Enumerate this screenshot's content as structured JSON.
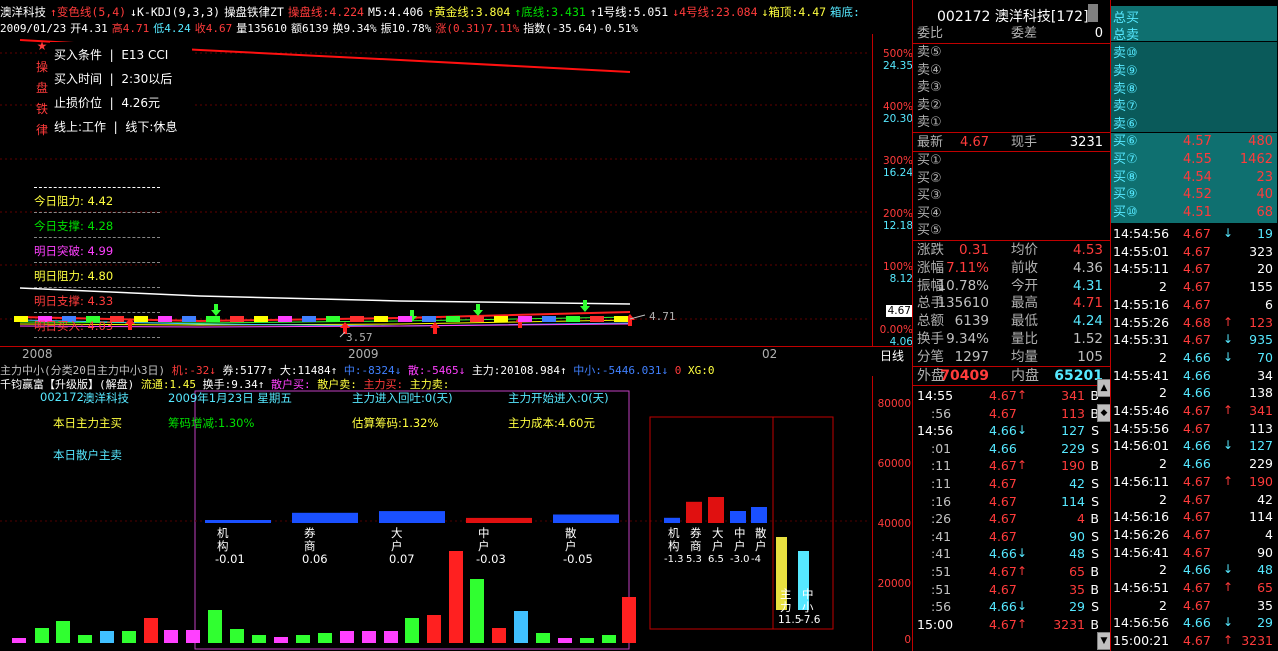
{
  "header": {
    "row1": [
      "澳洋科技",
      "↑变色线(5,4)",
      "↓K-KDJ(9,3,3)",
      "操盘铁律ZT",
      "操盘线:4.224",
      "M5:4.406",
      "↑黄金线:3.804",
      "↑底线:3.431",
      "↑1号线:5.051",
      "↓4号线:23.084",
      "↓箱顶:4.47",
      "箱底:"
    ],
    "row2": [
      "2009/01/23",
      "开4.31",
      "高4.71",
      "低4.24",
      "收4.67",
      "量135610",
      "额6139",
      "换9.34%",
      "振10.78%",
      "涨(0.31)7.11%",
      "指数(-35.64)-0.51%"
    ]
  },
  "kchart": {
    "vertical_text": [
      "★",
      "操",
      "盘",
      "铁",
      "律"
    ],
    "buy_card": [
      {
        "k": "买入条件",
        "v": "E13 CCI"
      },
      {
        "k": "买入时间",
        "v": "2:30以后"
      },
      {
        "k": "止损价位",
        "v": "4.26元"
      },
      {
        "k": "线上:工作",
        "v": "线下:休息"
      }
    ],
    "levels": [
      {
        "label": "今日阻力:",
        "value": "4.42",
        "color": "#ffff40"
      },
      {
        "label": "今日支撑:",
        "value": "4.28",
        "color": "#00e000"
      },
      {
        "label": "明日突破:",
        "value": "4.99",
        "color": "#ff40ff"
      },
      {
        "label": "明日阻力:",
        "value": "4.80",
        "color": "#ffff40"
      },
      {
        "label": "明日支撑:",
        "value": "4.33",
        "color": "#ff3b3b"
      },
      {
        "label": "明日买入:",
        "value": "4.03",
        "color": "#ff3b3b"
      }
    ],
    "price_marker": "4.71",
    "low_marker": "3.57",
    "x_labels": [
      "2008",
      "2009",
      "02"
    ],
    "period_label": "日线"
  },
  "scale": [
    {
      "pct": "500%",
      "price": "24.35"
    },
    {
      "pct": "400%",
      "price": "20.30"
    },
    {
      "pct": "300%",
      "price": "16.24"
    },
    {
      "pct": "200%",
      "price": "12.18"
    },
    {
      "pct": "100%",
      "price": "8.12"
    },
    {
      "pct": "",
      "price": "4.67"
    },
    {
      "pct": "0.00%",
      "price": "4.06"
    }
  ],
  "lower": {
    "title1": [
      "主力中小(分类20日主力中小3日)",
      "机:-32↓",
      "券:5177↑",
      "大:11484↑",
      "中:-8324↓",
      "散:-5465↓",
      "主力:20108.984↑",
      "中小:-5446.031↓",
      "0",
      "XG:0"
    ],
    "title2": [
      "千钧赢富【升级版】(解盘)",
      "流通:1.45",
      "换手:9.34↑",
      "散户买:",
      "散户卖:",
      "主力买:",
      "主力卖:"
    ],
    "info": {
      "code": "002172",
      "name": "澳洋科技",
      "date": "2009年1月23日 星期五",
      "enter_back": "主力进入回吐:0(天)",
      "start": "主力开始进入:0(天)",
      "today_main": "本日主力主买",
      "chip_change": "筹码增减:1.30%",
      "est_chip": "估算筹码:1.32%",
      "cost": "主力成本:4.60元",
      "today_retail": "本日散户主卖"
    },
    "categories": [
      {
        "name": "机构",
        "value": "-0.01"
      },
      {
        "name": "券商",
        "value": "0.06"
      },
      {
        "name": "大户",
        "value": "0.07"
      },
      {
        "name": "中户",
        "value": "-0.03"
      },
      {
        "name": "散户",
        "value": "-0.05"
      }
    ],
    "mini_labels": [
      {
        "name": "机构",
        "value": "-1.3"
      },
      {
        "name": "券商",
        "value": "5.3"
      },
      {
        "name": "大户",
        "value": "6.5"
      },
      {
        "name": "中户",
        "value": "-3.0"
      },
      {
        "name": "散户",
        "value": "-4"
      }
    ],
    "main_small": [
      {
        "name": "主力",
        "value": "11.5"
      },
      {
        "name": "中小",
        "value": "-7.6"
      }
    ],
    "vol_scale": [
      "80000",
      "60000",
      "40000",
      "20000",
      "0"
    ]
  },
  "quote": {
    "title": "002172 澳洋科技[172]",
    "wb_label": "委比",
    "wc_label": "委差",
    "wc_value": "0",
    "sells": [
      "卖⑤",
      "卖④",
      "卖③",
      "卖②",
      "卖①"
    ],
    "buys": [
      "买①",
      "买②",
      "买③",
      "买④",
      "买⑤"
    ],
    "last": {
      "k": "最新",
      "v": "4.67",
      "k2": "现手",
      "v2": "3231"
    },
    "stats": [
      {
        "k": "涨跌",
        "v": "0.31",
        "k2": "均价",
        "v2": "4.53",
        "c": "#ff3b3b",
        "c2": "#ff3b3b"
      },
      {
        "k": "涨幅",
        "v": "7.11%",
        "k2": "前收",
        "v2": "4.36",
        "c": "#ff3b3b",
        "c2": "#c0c0c0"
      },
      {
        "k": "振幅",
        "v": "10.78%",
        "k2": "今开",
        "v2": "4.31",
        "c": "#c0c0c0",
        "c2": "#56e8ff"
      },
      {
        "k": "总手",
        "v": "135610",
        "k2": "最高",
        "v2": "4.71",
        "c": "#c0c0c0",
        "c2": "#ff3b3b"
      },
      {
        "k": "总额",
        "v": "6139",
        "k2": "最低",
        "v2": "4.24",
        "c": "#c0c0c0",
        "c2": "#56e8ff"
      },
      {
        "k": "换手",
        "v": "9.34%",
        "k2": "量比",
        "v2": "1.52",
        "c": "#c0c0c0",
        "c2": "#c0c0c0"
      },
      {
        "k": "分笔",
        "v": "1297",
        "k2": "均量",
        "v2": "105",
        "c": "#c0c0c0",
        "c2": "#c0c0c0"
      }
    ],
    "outer": {
      "k": "外盘",
      "v": "70409",
      "k2": "内盘",
      "v2": "65201"
    },
    "ticks": [
      {
        "t": "14:55",
        "p": "4.67",
        "a": "↑",
        "v": "341",
        "s": "B"
      },
      {
        "t": ":56",
        "p": "4.67",
        "a": "",
        "v": "113",
        "s": "B"
      },
      {
        "t": "14:56",
        "p": "4.66",
        "a": "↓",
        "v": "127",
        "s": "S"
      },
      {
        "t": ":01",
        "p": "4.66",
        "a": "",
        "v": "229",
        "s": "S"
      },
      {
        "t": ":11",
        "p": "4.67",
        "a": "↑",
        "v": "190",
        "s": "B"
      },
      {
        "t": ":11",
        "p": "4.67",
        "a": "",
        "v": "42",
        "s": "S"
      },
      {
        "t": ":16",
        "p": "4.67",
        "a": "",
        "v": "114",
        "s": "S"
      },
      {
        "t": ":26",
        "p": "4.67",
        "a": "",
        "v": "4",
        "s": "B"
      },
      {
        "t": ":41",
        "p": "4.67",
        "a": "",
        "v": "90",
        "s": "S"
      },
      {
        "t": ":41",
        "p": "4.66",
        "a": "↓",
        "v": "48",
        "s": "S"
      },
      {
        "t": ":51",
        "p": "4.67",
        "a": "↑",
        "v": "65",
        "s": "B"
      },
      {
        "t": ":51",
        "p": "4.67",
        "a": "",
        "v": "35",
        "s": "B"
      },
      {
        "t": ":56",
        "p": "4.66",
        "a": "↓",
        "v": "29",
        "s": "S"
      },
      {
        "t": "15:00",
        "p": "4.67",
        "a": "↑",
        "v": "3231",
        "s": "B"
      }
    ]
  },
  "detail": {
    "total_buy": "总买",
    "total_sell": "总卖",
    "sell_levels": [
      "卖⑩",
      "卖⑨",
      "卖⑧",
      "卖⑦",
      "卖⑥"
    ],
    "buy_levels": [
      {
        "k": "买⑥",
        "p": "4.57",
        "v": "480"
      },
      {
        "k": "买⑦",
        "p": "4.55",
        "v": "1462"
      },
      {
        "k": "买⑧",
        "p": "4.54",
        "v": "23"
      },
      {
        "k": "买⑨",
        "p": "4.52",
        "v": "40"
      },
      {
        "k": "买⑩",
        "p": "4.51",
        "v": "68"
      }
    ],
    "ticks": [
      {
        "t": "14:54:56",
        "p": "4.67",
        "a": "↓",
        "v": "19",
        "c": "#56e8ff"
      },
      {
        "t": "14:55:01",
        "p": "4.67",
        "a": "",
        "v": "323",
        "c": "#fff"
      },
      {
        "t": "14:55:11",
        "p": "4.67",
        "a": "",
        "v": "20",
        "c": "#fff"
      },
      {
        "t": "2",
        "p": "4.67",
        "a": "",
        "v": "155",
        "c": "#fff"
      },
      {
        "t": "14:55:16",
        "p": "4.67",
        "a": "",
        "v": "6",
        "c": "#fff"
      },
      {
        "t": "14:55:26",
        "p": "4.68",
        "a": "↑",
        "v": "123",
        "c": "#ff3b3b"
      },
      {
        "t": "14:55:31",
        "p": "4.67",
        "a": "↓",
        "v": "935",
        "c": "#56e8ff"
      },
      {
        "t": "2",
        "p": "4.66",
        "a": "↓",
        "v": "70",
        "c": "#56e8ff"
      },
      {
        "t": "14:55:41",
        "p": "4.66",
        "a": "",
        "v": "34",
        "c": "#fff"
      },
      {
        "t": "2",
        "p": "4.66",
        "a": "",
        "v": "138",
        "c": "#fff"
      },
      {
        "t": "14:55:46",
        "p": "4.67",
        "a": "↑",
        "v": "341",
        "c": "#ff3b3b"
      },
      {
        "t": "14:55:56",
        "p": "4.67",
        "a": "",
        "v": "113",
        "c": "#fff"
      },
      {
        "t": "14:56:01",
        "p": "4.66",
        "a": "↓",
        "v": "127",
        "c": "#56e8ff"
      },
      {
        "t": "2",
        "p": "4.66",
        "a": "",
        "v": "229",
        "c": "#fff"
      },
      {
        "t": "14:56:11",
        "p": "4.67",
        "a": "↑",
        "v": "190",
        "c": "#ff3b3b"
      },
      {
        "t": "2",
        "p": "4.67",
        "a": "",
        "v": "42",
        "c": "#fff"
      },
      {
        "t": "14:56:16",
        "p": "4.67",
        "a": "",
        "v": "114",
        "c": "#fff"
      },
      {
        "t": "14:56:26",
        "p": "4.67",
        "a": "",
        "v": "4",
        "c": "#fff"
      },
      {
        "t": "14:56:41",
        "p": "4.67",
        "a": "",
        "v": "90",
        "c": "#fff"
      },
      {
        "t": "2",
        "p": "4.66",
        "a": "↓",
        "v": "48",
        "c": "#56e8ff"
      },
      {
        "t": "14:56:51",
        "p": "4.67",
        "a": "↑",
        "v": "65",
        "c": "#ff3b3b"
      },
      {
        "t": "2",
        "p": "4.67",
        "a": "",
        "v": "35",
        "c": "#fff"
      },
      {
        "t": "14:56:56",
        "p": "4.66",
        "a": "↓",
        "v": "29",
        "c": "#56e8ff"
      },
      {
        "t": "15:00:21",
        "p": "4.67",
        "a": "↑",
        "v": "3231",
        "c": "#ff3b3b"
      }
    ]
  }
}
